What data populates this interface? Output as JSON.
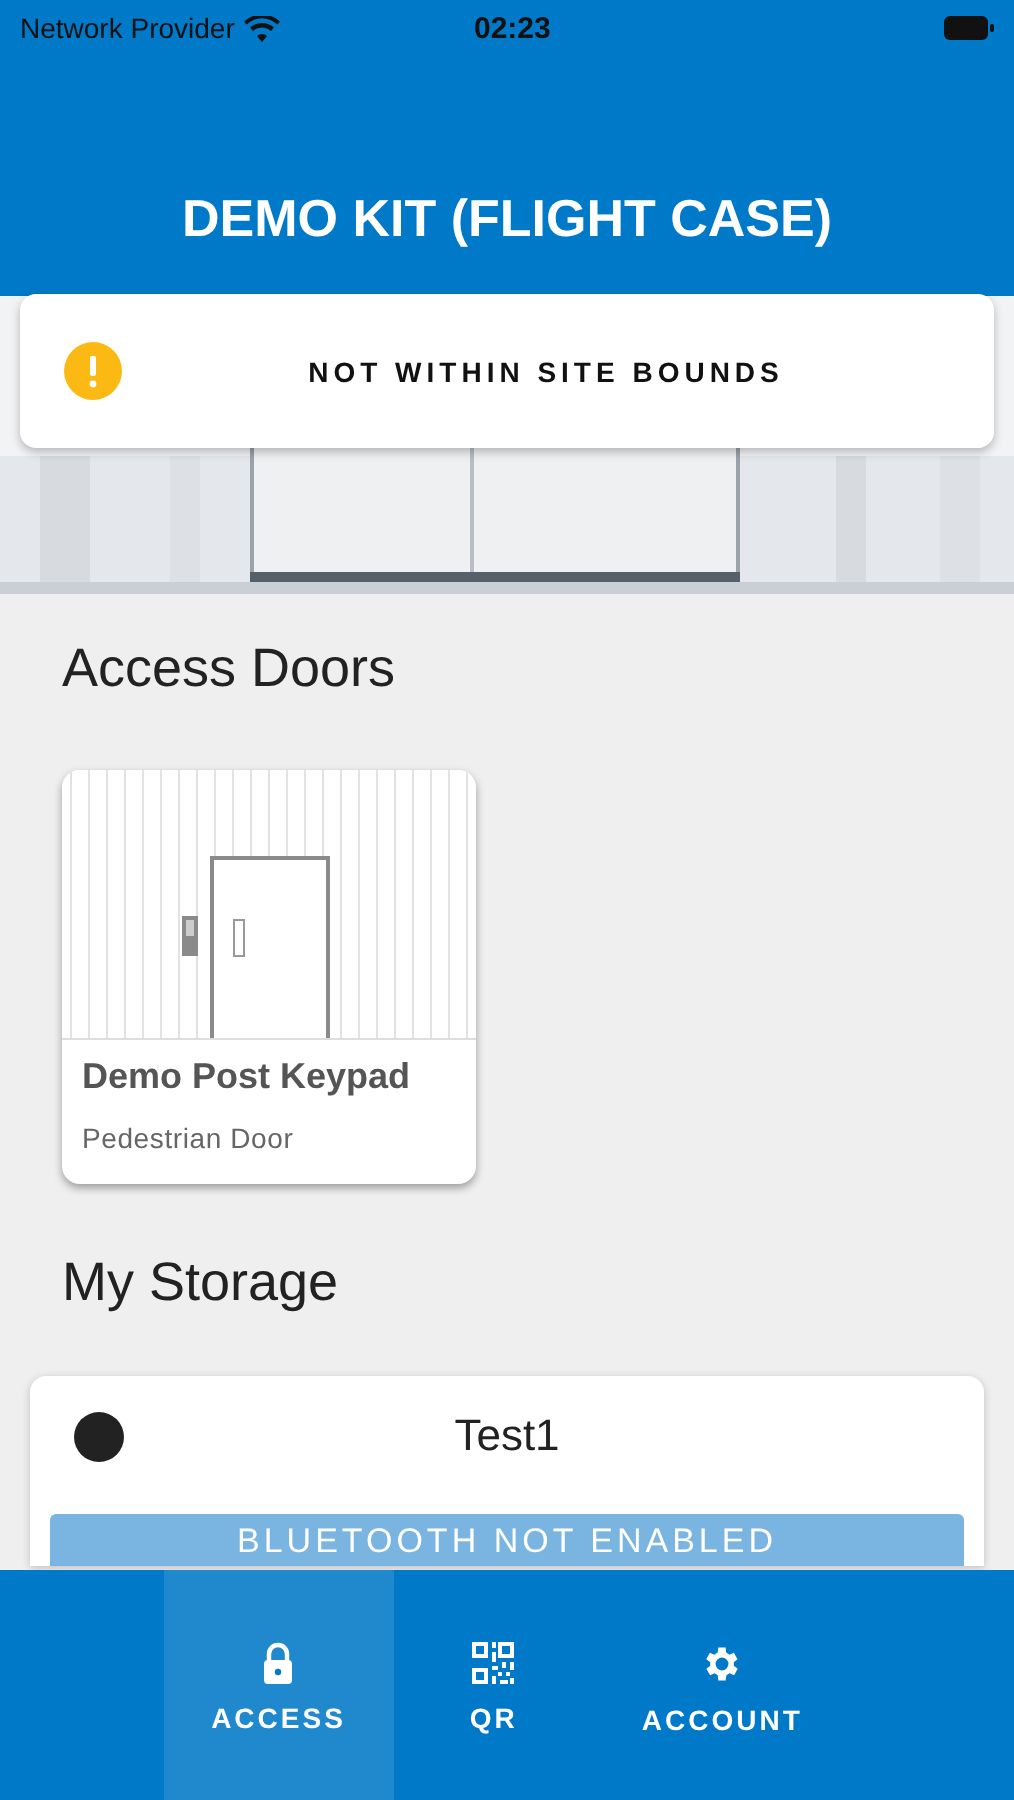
{
  "status_bar": {
    "carrier": "Network Provider",
    "time": "02:23"
  },
  "header": {
    "title": "DEMO KIT (FLIGHT CASE)"
  },
  "alert": {
    "message": "NOT WITHIN SITE BOUNDS"
  },
  "access_doors": {
    "heading": "Access Doors",
    "doors": [
      {
        "name": "Demo Post Keypad",
        "type": "Pedestrian Door"
      }
    ]
  },
  "my_storage": {
    "heading": "My Storage",
    "units": [
      {
        "name": "Test1",
        "button": "BLUETOOTH NOT ENABLED",
        "disabled": true
      }
    ]
  },
  "bottom_nav": [
    {
      "kind": "lock",
      "label": "ACCESS",
      "selected": true
    },
    {
      "kind": "qr",
      "label": "QR",
      "selected": false
    },
    {
      "kind": "gear",
      "label": "ACCOUNT",
      "selected": false
    }
  ]
}
